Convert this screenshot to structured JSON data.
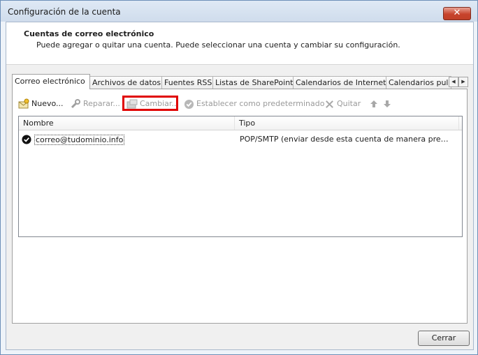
{
  "window": {
    "title": "Configuración de la cuenta",
    "close_label": "✕"
  },
  "header": {
    "title": "Cuentas de correo electrónico",
    "description": "Puede agregar o quitar una cuenta. Puede seleccionar una cuenta y cambiar su configuración."
  },
  "tabs": [
    {
      "label": "Correo electrónico",
      "active": true
    },
    {
      "label": "Archivos de datos",
      "active": false
    },
    {
      "label": "Fuentes RSS",
      "active": false
    },
    {
      "label": "Listas de SharePoint",
      "active": false
    },
    {
      "label": "Calendarios de Internet",
      "active": false
    },
    {
      "label": "Calendarios pul",
      "active": false
    }
  ],
  "tab_scroll": {
    "left": "◀",
    "right": "▶"
  },
  "toolbar": {
    "new_label": "Nuevo...",
    "repair_label": "Reparar...",
    "change_label": "Cambiar...",
    "default_label": "Establecer como predeterminado",
    "remove_label": "Quitar"
  },
  "accounts_list": {
    "columns": [
      "Nombre",
      "Tipo"
    ],
    "rows": [
      {
        "name": "correo@tudominio.info",
        "type": "POP/SMTP (enviar desde esta cuenta de manera predete..."
      }
    ]
  },
  "footer": {
    "close_button_label": "Cerrar"
  },
  "colors": {
    "highlight": "#e00000",
    "close_button": "#c7432c"
  }
}
